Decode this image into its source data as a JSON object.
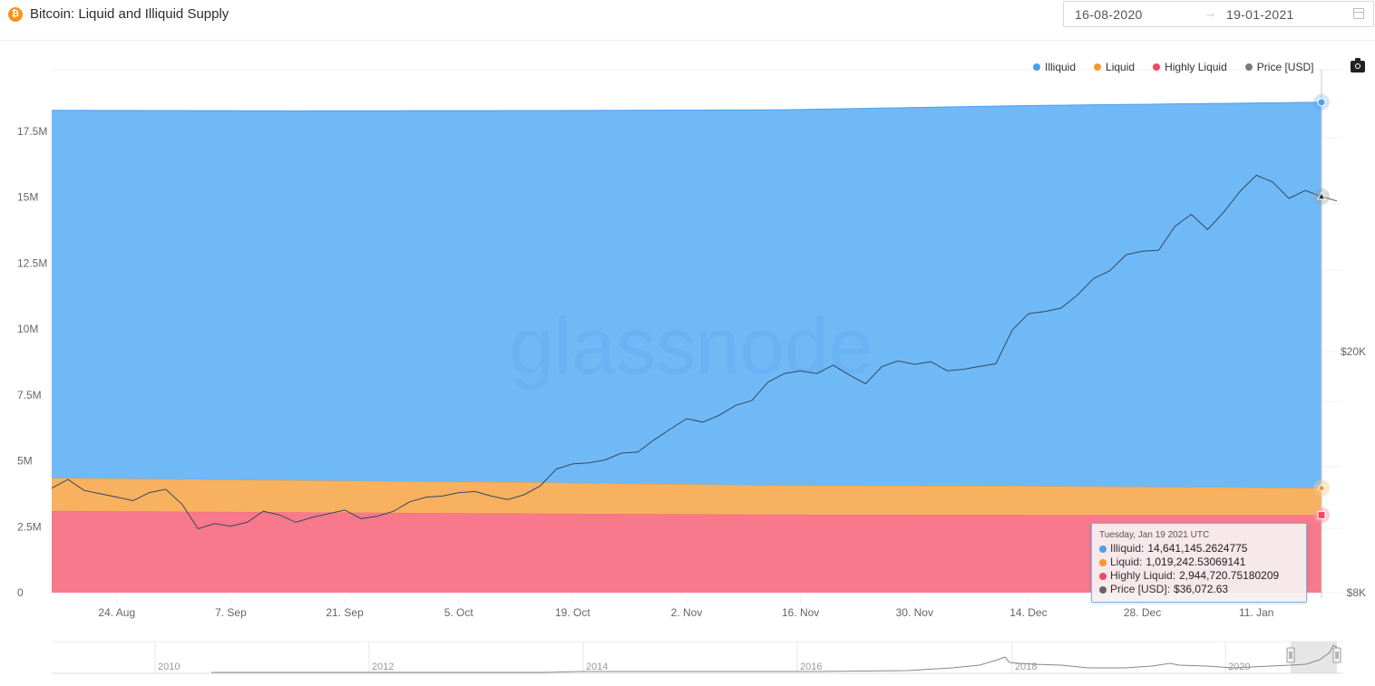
{
  "header": {
    "title": "Bitcoin: Liquid and Illiquid Supply",
    "icon": "bitcoin-icon",
    "date_from": "16-08-2020",
    "date_to": "19-01-2021",
    "arrow": "→",
    "calendar_icon": "calendar-icon"
  },
  "toolbar": {
    "export_icon": "camera-icon"
  },
  "watermark": "glassnode",
  "tooltip": {
    "date": "Tuesday, Jan 19 2021 UTC",
    "rows": [
      {
        "label": "Illiquid",
        "value": "14,641,145.2624775",
        "color": "#4a9ff0"
      },
      {
        "label": "Liquid",
        "value": "1,019,242.53069141",
        "color": "#f7982d"
      },
      {
        "label": "Highly Liquid",
        "value": "2,944,720.75180209",
        "color": "#ef4a60"
      },
      {
        "label": "Price [USD]",
        "value": "$36,072.63",
        "color": "#666666"
      }
    ]
  },
  "navigator": {
    "year_labels": [
      "2010",
      "2012",
      "2014",
      "2016",
      "2018",
      "2020"
    ]
  },
  "chart_data": {
    "type": "area",
    "title": "Bitcoin: Liquid and Illiquid Supply",
    "stacked": true,
    "x_range": [
      "2020-08-16",
      "2021-01-19"
    ],
    "x_tick_labels": [
      "24. Aug",
      "7. Sep",
      "21. Sep",
      "5. Oct",
      "19. Oct",
      "2. Nov",
      "16. Nov",
      "30. Nov",
      "14. Dec",
      "28. Dec",
      "11. Jan"
    ],
    "x_tick_days": [
      8,
      22,
      36,
      50,
      64,
      78,
      92,
      106,
      120,
      134,
      148
    ],
    "y_left": {
      "ticks": [
        0,
        2500000,
        5000000,
        7500000,
        10000000,
        12500000,
        15000000,
        17500000
      ],
      "tick_labels": [
        "0",
        "2.5M",
        "5M",
        "7.5M",
        "10M",
        "12.5M",
        "15M",
        "17.5M"
      ],
      "range": [
        0,
        18500000
      ]
    },
    "y_right": {
      "scale": "log",
      "tick_labels": [
        "$8K",
        "$20K"
      ],
      "ticks": [
        8000,
        20000
      ]
    },
    "legend": [
      {
        "name": "Illiquid",
        "color": "#4a9ff0"
      },
      {
        "name": "Liquid",
        "color": "#f7982d"
      },
      {
        "name": "Highly Liquid",
        "color": "#ef4a60"
      },
      {
        "name": "Price [USD]",
        "color": "#7a7a7a"
      }
    ],
    "legend_position": "top-right",
    "series": [
      {
        "name": "Highly Liquid",
        "color": "#f7798b",
        "axis": "left",
        "x_days": [
          0,
          30,
          60,
          90,
          120,
          156
        ],
        "values": [
          3100000,
          3050000,
          3000000,
          2960000,
          2950000,
          2944720.75
        ]
      },
      {
        "name": "Liquid",
        "color": "#f8b15e",
        "axis": "left",
        "x_days": [
          0,
          30,
          60,
          90,
          120,
          156
        ],
        "values": [
          1250000,
          1210000,
          1180000,
          1110000,
          1100000,
          1019242.53
        ]
      },
      {
        "name": "Illiquid",
        "color": "#6fb9f6",
        "axis": "left",
        "x_days": [
          0,
          30,
          60,
          90,
          120,
          156
        ],
        "values": [
          13950000,
          14020000,
          14110000,
          14250000,
          14430000,
          14641145.26
        ]
      },
      {
        "name": "Price [USD]",
        "color": "#3b4a5a",
        "axis": "right",
        "x_days": [
          0,
          2,
          4,
          6,
          8,
          10,
          12,
          14,
          16,
          18,
          20,
          22,
          24,
          26,
          28,
          30,
          32,
          34,
          36,
          38,
          40,
          42,
          44,
          46,
          48,
          50,
          52,
          54,
          56,
          58,
          60,
          62,
          64,
          66,
          68,
          70,
          72,
          74,
          76,
          78,
          80,
          82,
          84,
          86,
          88,
          90,
          92,
          94,
          96,
          98,
          100,
          102,
          104,
          106,
          108,
          110,
          112,
          114,
          116,
          118,
          120,
          122,
          124,
          126,
          128,
          130,
          132,
          134,
          136,
          138,
          140,
          142,
          144,
          146,
          148,
          150,
          152,
          154,
          156
        ],
        "values": [
          11900,
          12300,
          11800,
          11650,
          11500,
          11350,
          11700,
          11850,
          11200,
          10200,
          10400,
          10300,
          10450,
          10900,
          10750,
          10450,
          10650,
          10800,
          10950,
          10600,
          10700,
          10900,
          11300,
          11500,
          11550,
          11700,
          11750,
          11550,
          11400,
          11600,
          12000,
          12800,
          13050,
          13100,
          13250,
          13600,
          13650,
          14300,
          14900,
          15500,
          15300,
          15700,
          16300,
          16600,
          17800,
          18400,
          18600,
          18400,
          19000,
          18300,
          17700,
          18900,
          19300,
          19050,
          19250,
          18600,
          18700,
          18900,
          19100,
          21700,
          23100,
          23300,
          23600,
          24800,
          26400,
          27200,
          28900,
          29300,
          29400,
          32200,
          33700,
          31800,
          34000,
          36800,
          39100,
          38100,
          35800,
          36900,
          36072.63
        ]
      }
    ]
  }
}
